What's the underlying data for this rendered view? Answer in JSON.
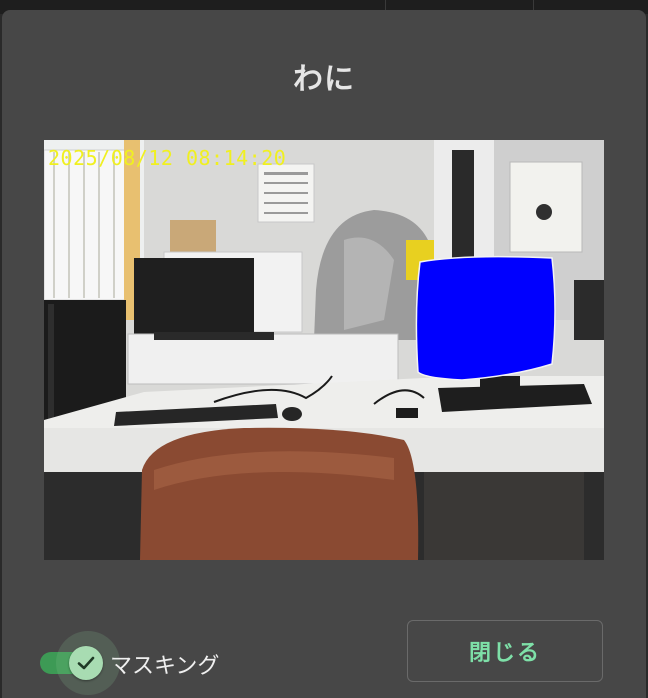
{
  "dialog": {
    "title": "わに"
  },
  "camera": {
    "timestamp": "2025/08/12 08:14:20",
    "mask_color": "#0000ff"
  },
  "masking": {
    "label": "マスキング",
    "enabled": true,
    "accent": "#3d9a55"
  },
  "actions": {
    "close_label": "閉じる",
    "close_color": "#7ee0a8"
  }
}
